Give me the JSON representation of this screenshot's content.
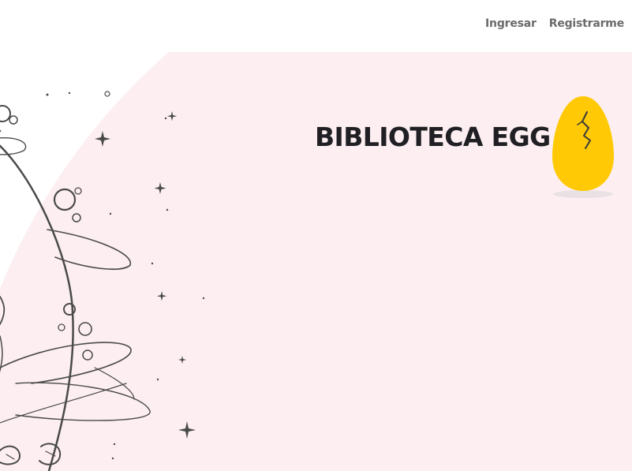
{
  "nav": {
    "login_label": "Ingresar",
    "register_label": "Registrarme"
  },
  "hero": {
    "title": "BIBLIOTECA EGG",
    "illustration_icon": "egg-planet-sketch",
    "logo_icon": "cracked-egg-icon"
  },
  "colors": {
    "background": "#ffffff",
    "hero_blob": "#fdeef1",
    "egg": "#ffc905",
    "nav_text": "#6b6b6b",
    "title_text": "#1f1f24",
    "sketch_stroke": "#4a4a4a"
  }
}
